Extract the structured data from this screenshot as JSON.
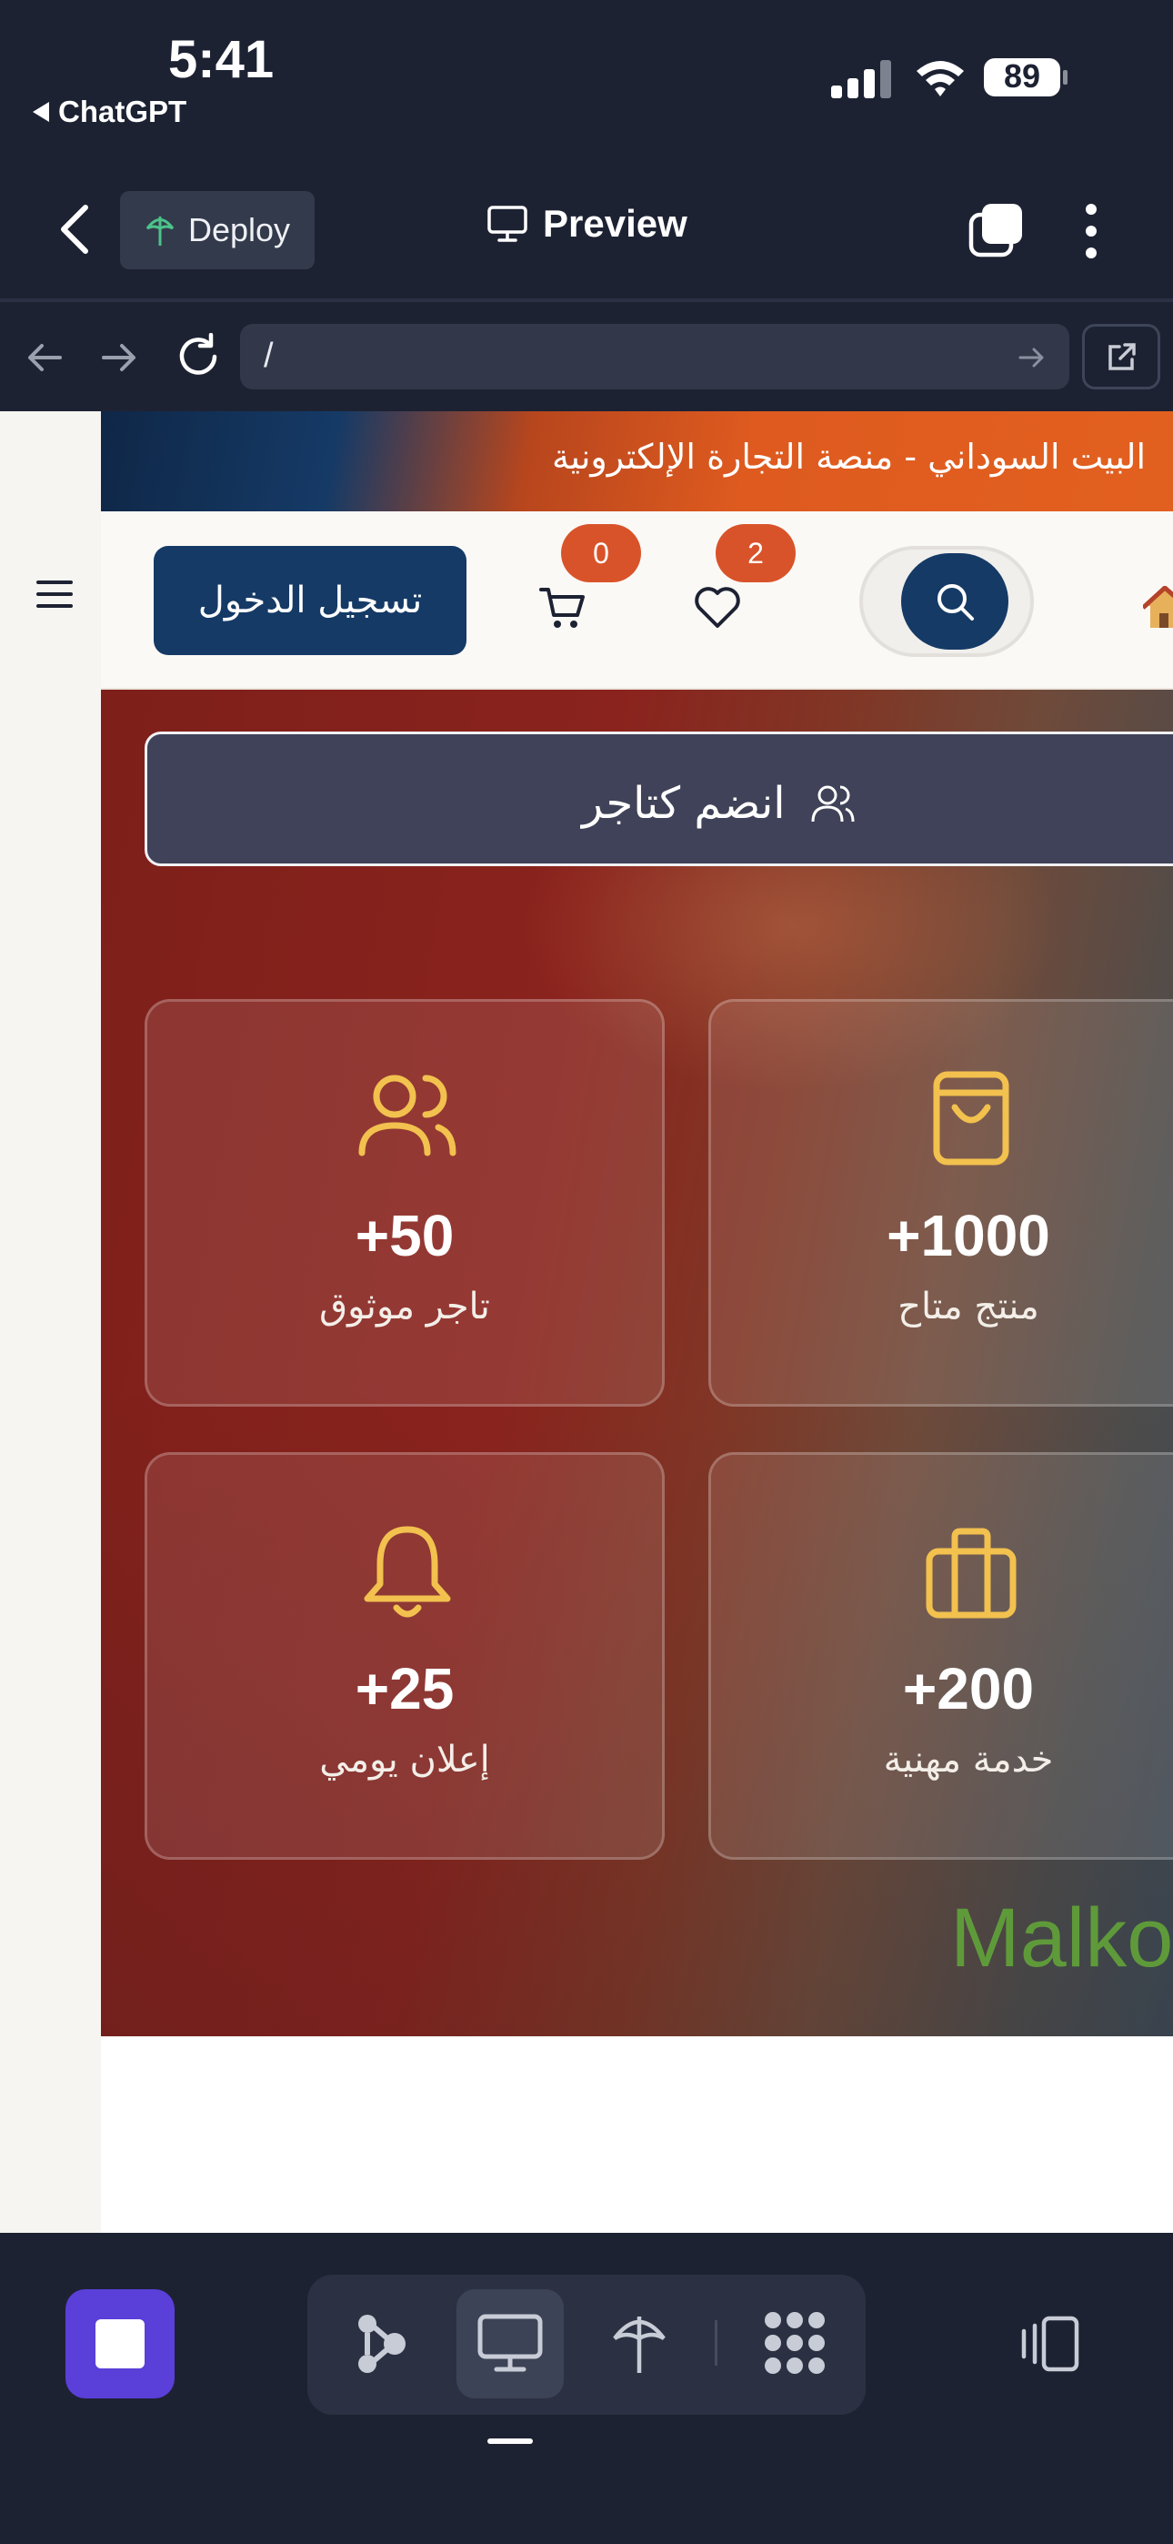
{
  "status_bar": {
    "time": "5:41",
    "back_app": "ChatGPT",
    "battery": "89"
  },
  "app_bar": {
    "deploy_label": "Deploy",
    "preview_label": "Preview"
  },
  "browser": {
    "url": "/"
  },
  "site": {
    "banner_text": "البيت السوداني - منصة التجارة الإلكترونية",
    "login_label": "تسجيل الدخول",
    "cart_count": "0",
    "wishlist_count": "2",
    "join_label": "انضم كتاجر",
    "stats": [
      {
        "value": "+50",
        "caption": "تاجر موثوق",
        "icon": "users-icon"
      },
      {
        "value": "+1000",
        "caption": "منتج متاح",
        "icon": "shopping-bag-icon"
      },
      {
        "value": "+25",
        "caption": "إعلان يومي",
        "icon": "bell-icon"
      },
      {
        "value": "+200",
        "caption": "خدمة مهنية",
        "icon": "briefcase-icon"
      }
    ],
    "brand_watermark": "Malko"
  },
  "colors": {
    "accent_navy": "#153a66",
    "badge_orange": "#d9532a",
    "icon_gold": "#f2c14e",
    "brand_green": "#5f9a3a",
    "stop_purple": "#5a3fd8"
  }
}
